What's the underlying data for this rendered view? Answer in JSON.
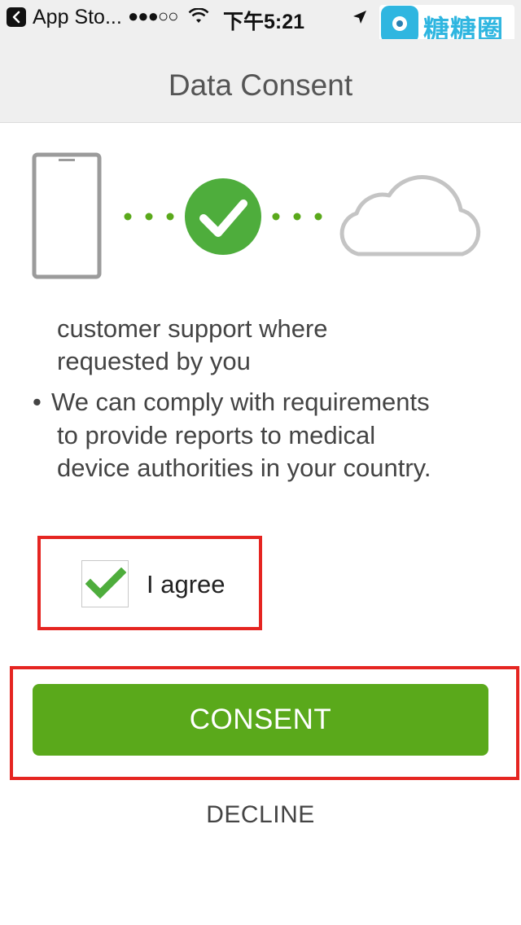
{
  "status_bar": {
    "back_app": "App Sto...",
    "signal": "●●●○○",
    "time": "下午5:21",
    "watermark_text": "糖糖圈"
  },
  "nav": {
    "title": "Data Consent"
  },
  "consent_text": {
    "lines": [
      "customer support where",
      "requested by you",
      "We can comply with requirements",
      "to provide reports to medical",
      "device authorities in your country."
    ],
    "bullet": "•"
  },
  "agree": {
    "label": "I agree",
    "checked": true
  },
  "actions": {
    "consent_label": "CONSENT",
    "decline_label": "DECLINE"
  },
  "icons": {
    "back": "chevron-left-icon",
    "wifi": "wifi-icon",
    "location": "location-arrow-icon",
    "phone": "phone-icon",
    "check": "checkmark-circle-icon",
    "cloud": "cloud-icon",
    "checkbox_check": "checkmark-icon"
  },
  "colors": {
    "accent_green": "#5aa91b",
    "check_green": "#4ead3c",
    "highlight_red": "#e52521",
    "nav_background": "#efefef"
  }
}
